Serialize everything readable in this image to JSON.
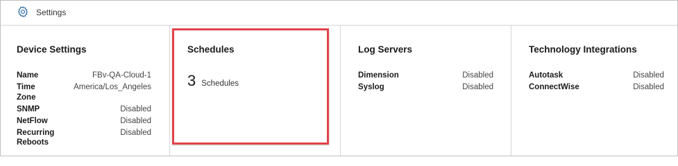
{
  "header": {
    "title": "Settings",
    "icon": "gear-icon"
  },
  "cards": {
    "device": {
      "title": "Device Settings",
      "rows": [
        {
          "key": "Name",
          "value": "FBv-QA-Cloud-1"
        },
        {
          "key": "Time Zone",
          "value": "America/Los_Angeles"
        },
        {
          "key": "SNMP",
          "value": "Disabled"
        },
        {
          "key": "NetFlow",
          "value": "Disabled"
        },
        {
          "key": "Recurring Reboots",
          "value": "Disabled"
        }
      ]
    },
    "schedules": {
      "title": "Schedules",
      "count": "3",
      "count_label": "Schedules",
      "highlight_color": "#e2434b"
    },
    "log": {
      "title": "Log Servers",
      "rows": [
        {
          "key": "Dimension",
          "value": "Disabled"
        },
        {
          "key": "Syslog",
          "value": "Disabled"
        }
      ]
    },
    "tech": {
      "title": "Technology Integrations",
      "rows": [
        {
          "key": "Autotask",
          "value": "Disabled"
        },
        {
          "key": "ConnectWise",
          "value": "Disabled"
        }
      ]
    }
  }
}
